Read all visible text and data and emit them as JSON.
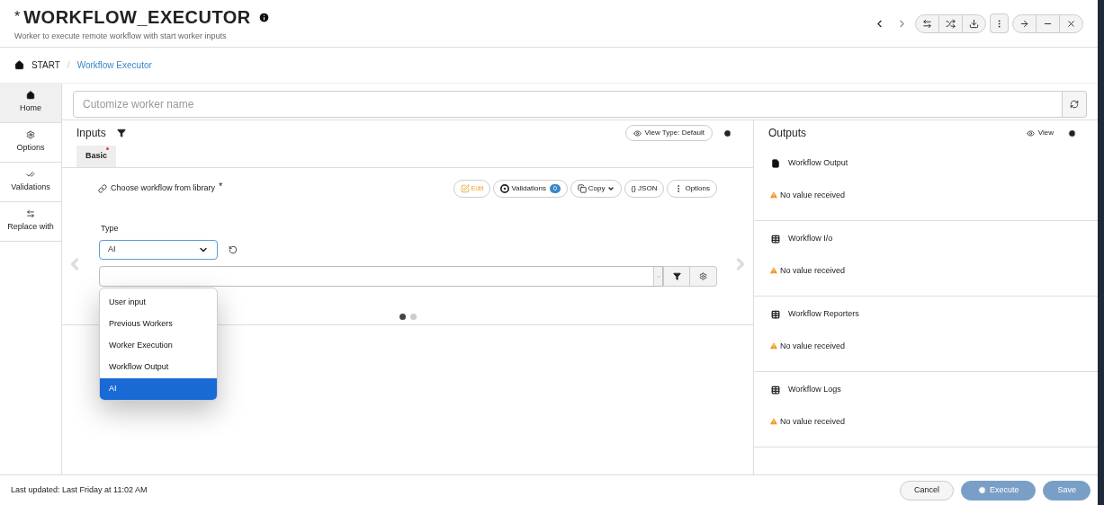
{
  "header": {
    "title_prefix": "*",
    "title": "WORKFLOW_EXECUTOR",
    "subtitle": "Worker to execute remote workflow with start worker inputs"
  },
  "breadcrumb": {
    "separator": "/",
    "items": [
      {
        "label": "START",
        "selected": false
      },
      {
        "label": "Workflow Executor",
        "selected": true
      }
    ]
  },
  "sidebar": {
    "items": [
      {
        "label": "Home",
        "kind": "home",
        "selected": true
      },
      {
        "label": "Options",
        "kind": "options",
        "selected": false
      },
      {
        "label": "Validations",
        "kind": "validations",
        "selected": false
      },
      {
        "label": "Replace with",
        "kind": "replace",
        "selected": false
      }
    ]
  },
  "worker_name": {
    "placeholder": "Cutomize worker name"
  },
  "inputs": {
    "title": "Inputs",
    "view_type": "View Type: Default",
    "tabs": [
      {
        "label": "Basic",
        "selected": true,
        "required": true
      }
    ],
    "field": {
      "label": "Choose workflow from library",
      "required_mark": "*",
      "actions": [
        {
          "label": "Edit",
          "kind": "edit"
        },
        {
          "label": "Validations",
          "kind": "validations",
          "count": "0"
        },
        {
          "label": "Copy",
          "kind": "copy"
        },
        {
          "label": "{} JSON",
          "kind": "json"
        },
        {
          "label": "Options",
          "kind": "options"
        }
      ]
    },
    "type": {
      "label": "Type",
      "value": "AI",
      "expanded": true,
      "options": [
        {
          "label": "User input",
          "selected": false
        },
        {
          "label": "Previous Workers",
          "selected": false
        },
        {
          "label": "Worker Execution",
          "selected": false
        },
        {
          "label": "Workflow Output",
          "selected": false
        },
        {
          "label": "AI",
          "selected": true
        }
      ]
    },
    "pager": [
      {
        "selected": true
      },
      {
        "selected": false
      }
    ]
  },
  "outputs": {
    "title": "Outputs",
    "view": "View",
    "items": [
      {
        "kind": "file",
        "title": "Workflow Output",
        "status": "No value received"
      },
      {
        "kind": "table",
        "title": "Workflow I/o",
        "status": "No value received"
      },
      {
        "kind": "table",
        "title": "Workflow Reporters",
        "status": "No value received"
      },
      {
        "kind": "table",
        "title": "Workflow Logs",
        "status": "No value received"
      }
    ]
  },
  "footer": {
    "last_updated": "Last updated: Last Friday at 11:02 AM",
    "buttons": [
      {
        "label": "Cancel",
        "kind": "cancel"
      },
      {
        "label": "Execute",
        "kind": "execute"
      },
      {
        "label": "Save",
        "kind": "save"
      }
    ]
  }
}
